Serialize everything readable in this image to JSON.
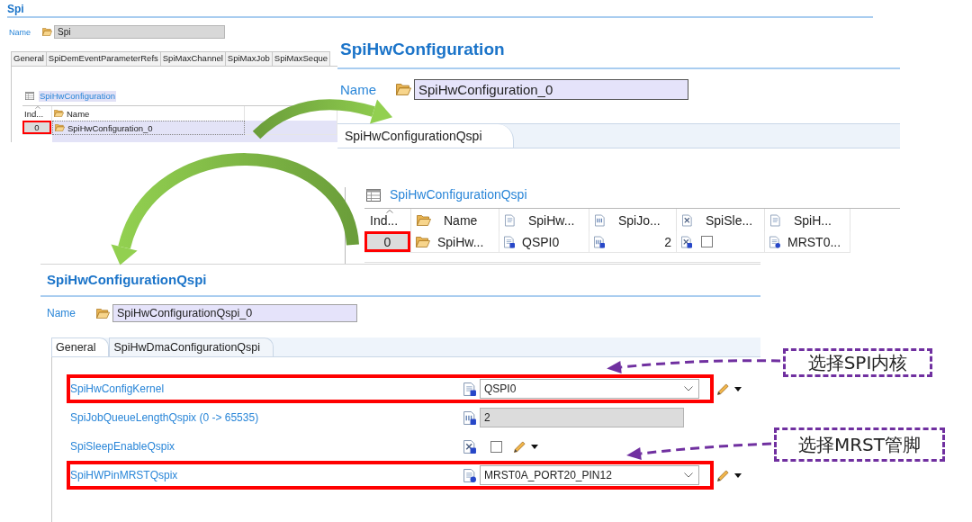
{
  "spi_panel": {
    "title": "Spi",
    "name_label": "Name",
    "name_value": "Spi",
    "tabs": [
      {
        "label": "General",
        "selected": false
      },
      {
        "label": "SpiDemEventParameterRefs",
        "selected": false
      },
      {
        "label": "SpiMaxChannel",
        "selected": false
      },
      {
        "label": "SpiMaxJob",
        "selected": false
      },
      {
        "label": "SpiMaxSeque",
        "selected": false
      }
    ],
    "table": {
      "title": "SpiHwConfiguration",
      "columns": [
        {
          "label": "Ind...",
          "kind": "index"
        },
        {
          "label": "Name",
          "kind": "name"
        }
      ],
      "rows": [
        {
          "highlighted": true,
          "cells": [
            {
              "text": "0"
            },
            {
              "text": "SpiHwConfiguration_0"
            }
          ]
        }
      ]
    }
  },
  "hw_configuration_panel": {
    "title": "SpiHwConfiguration",
    "name_label": "Name",
    "name_value": "SpiHwConfiguration_0",
    "tabs": [
      {
        "label": "SpiHwConfigurationQspi",
        "selected": true
      }
    ],
    "table": {
      "title": "SpiHwConfigurationQspi",
      "columns": [
        {
          "label": "Ind...",
          "kind": "index"
        },
        {
          "label": "Name",
          "kind": "name"
        },
        {
          "label": "SpiHw...",
          "kind": "enum"
        },
        {
          "label": "SpiJo...",
          "kind": "integer"
        },
        {
          "label": "SpiSle...",
          "kind": "boolean"
        },
        {
          "label": "SpiH...",
          "kind": "reference"
        }
      ],
      "rows": [
        {
          "highlighted": true,
          "cells": [
            {
              "text": "0"
            },
            {
              "text": "SpiHw..."
            },
            {
              "text": "QSPI0"
            },
            {
              "text": "2"
            },
            {
              "checked": false
            },
            {
              "text": "MRST0..."
            }
          ]
        }
      ]
    }
  },
  "qspi_panel": {
    "title": "SpiHwConfigurationQspi",
    "name_label": "Name",
    "name_value": "SpiHwConfigurationQspi_0",
    "tabs": [
      {
        "label": "General",
        "selected": true
      },
      {
        "label": "SpiHwDmaConfigurationQspi",
        "selected": false
      }
    ],
    "parameters": [
      {
        "label": "SpiHwConfigKernel",
        "kind": "enum",
        "value": "QSPI0",
        "highlighted": true
      },
      {
        "label": "SpiJobQueueLengthQspix (0 -> 65535)",
        "kind": "integer",
        "value": "2",
        "highlighted": false
      },
      {
        "label": "SpiSleepEnableQspix",
        "kind": "boolean",
        "checked": false,
        "highlighted": false
      },
      {
        "label": "SpiHWPinMRSTQspix",
        "kind": "reference",
        "value": "MRST0A_PORT20_PIN12",
        "highlighted": true
      }
    ]
  },
  "callouts": [
    {
      "text": "选择SPI内核"
    },
    {
      "text": "选择MRST管脚"
    }
  ]
}
